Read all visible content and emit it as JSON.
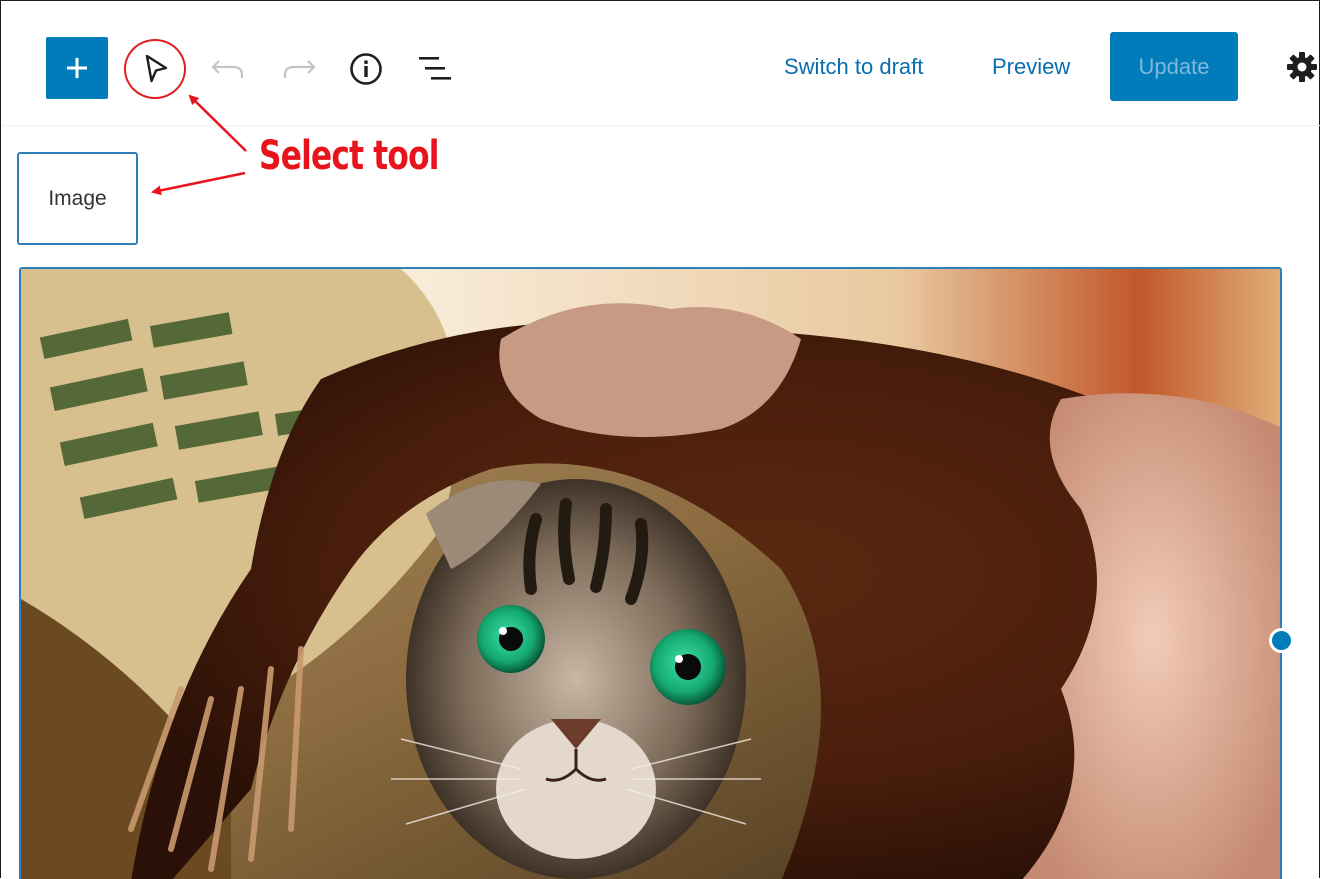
{
  "toolbar": {
    "inserter_icon": "plus-icon",
    "select_tool_icon": "cursor-arrow-icon",
    "undo_icon": "undo-icon",
    "redo_icon": "redo-icon",
    "info_icon": "info-icon",
    "outline_icon": "list-view-icon",
    "switch_to_draft_label": "Switch to draft",
    "preview_label": "Preview",
    "update_label": "Update",
    "settings_icon": "gear-icon"
  },
  "block_breadcrumb": {
    "label": "Image"
  },
  "annotation": {
    "text": "Select tool"
  },
  "image_block": {
    "subject": "kitten-under-blanket-photo"
  },
  "colors": {
    "accent": "#007cba",
    "link": "#0a6eae",
    "annotation_red": "#e8141b",
    "selection_border": "#2f7fb8"
  }
}
